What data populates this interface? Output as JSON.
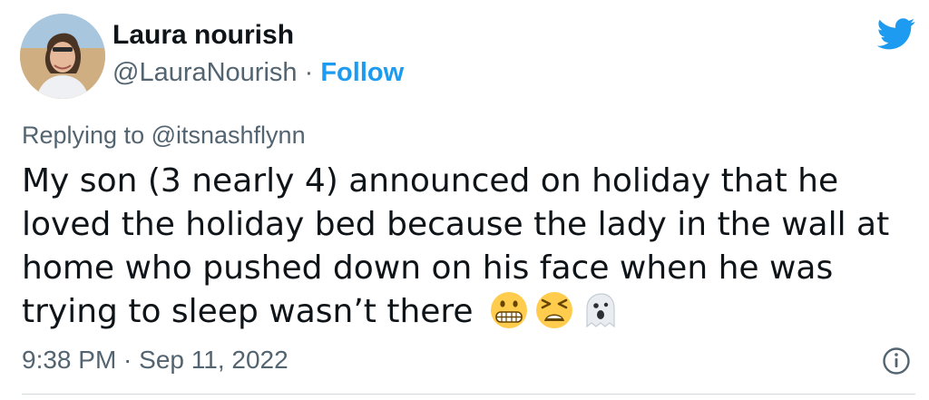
{
  "author": {
    "display_name": "Laura nourish",
    "handle": "@LauraNourish",
    "separator": " · ",
    "follow_label": "Follow"
  },
  "reply": {
    "prefix": "Replying to ",
    "mention": "@itsnashflynn"
  },
  "tweet": {
    "text": "My son (3 nearly 4) announced on holiday that he loved the holiday bed because the lady in the wall at home who pushed down on his face when he was trying to sleep wasn’t there",
    "emojis": [
      "grimacing-face-icon",
      "tired-face-icon",
      "ghost-icon"
    ]
  },
  "meta": {
    "timestamp": "9:38 PM · Sep 11, 2022"
  },
  "colors": {
    "accent": "#1d9bf0",
    "text": "#0f1419",
    "muted": "#536471",
    "divider": "#cfd9de"
  },
  "icons": {
    "brand": "twitter-bird-icon",
    "info": "info-icon"
  }
}
